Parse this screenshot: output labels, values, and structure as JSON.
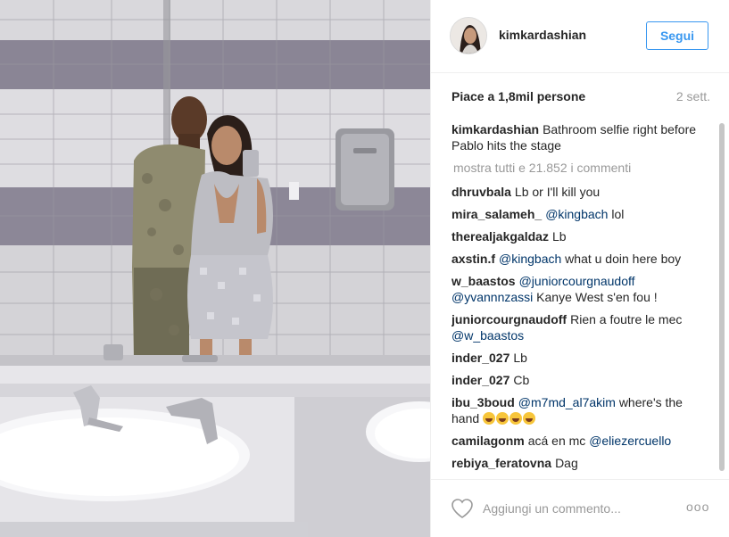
{
  "post": {
    "photo_icon": "bathroom-selfie-photo"
  },
  "header": {
    "username": "kimkardashian",
    "follow_label": "Segui",
    "avatar_icon": "profile-avatar"
  },
  "stats": {
    "likes": "Piace a 1,8mil persone",
    "time_ago": "2 sett."
  },
  "caption": {
    "author": "kimkardashian",
    "text": "Bathroom selfie right before Pablo hits the stage"
  },
  "load_more": "mostra tutti e 21.852 i commenti",
  "comments": [
    {
      "author": "dhruvbala",
      "text": "Lb or I'll kill you"
    },
    {
      "author": "mira_salameh_",
      "mention": "@kingbach",
      "text": "lol"
    },
    {
      "author": "therealjakgaldaz",
      "text": "Lb"
    },
    {
      "author": "axstin.f",
      "mention": "@kingbach",
      "text": "what u doin here boy"
    },
    {
      "author": "w_baastos",
      "mention": "@juniorcourgnaudoff",
      "mention2": "@yvannnzassi",
      "text": "Kanye West s'en fou !"
    },
    {
      "author": "juniorcourgnaudoff",
      "text": "Rien a foutre le mec",
      "mention": "@w_baastos"
    },
    {
      "author": "inder_027",
      "text": "Lb"
    },
    {
      "author": "inder_027",
      "text": "Cb"
    },
    {
      "author": "ibu_3boud",
      "mention": "@m7md_al7akim",
      "text": "where's the hand"
    },
    {
      "author": "camilagonm",
      "text": "acá en mc",
      "mention": "@eliezercuello"
    },
    {
      "author": "rebiya_feratovna",
      "text": "Dag"
    }
  ],
  "footer": {
    "comment_placeholder": "Aggiungi un commento...",
    "heart_icon": "heart-icon",
    "more_icon": "more-options-icon",
    "more_glyph": "ooo"
  }
}
